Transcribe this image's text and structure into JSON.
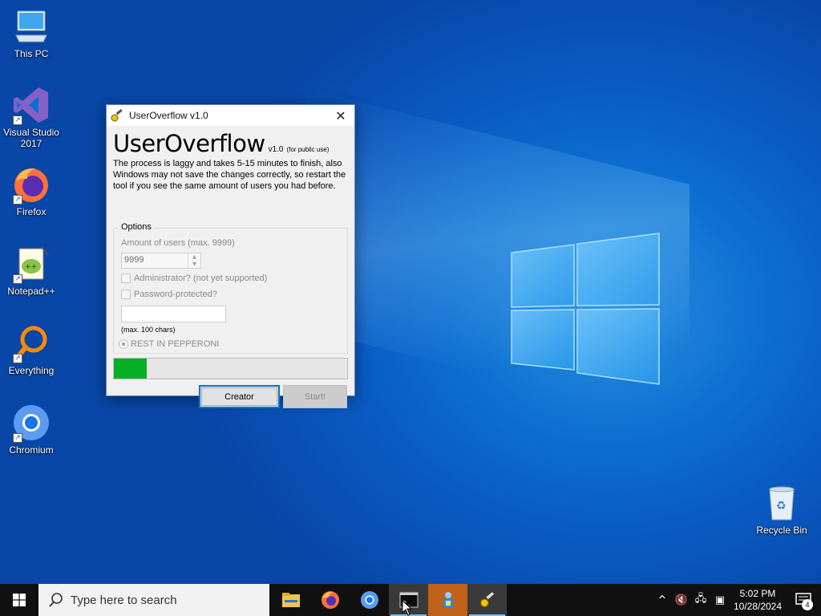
{
  "desktop": {
    "icons": [
      {
        "label": "This PC",
        "icon": "computer-icon"
      },
      {
        "label": "Visual Studio\n2017",
        "icon": "visual-studio-icon"
      },
      {
        "label": "Firefox",
        "icon": "firefox-icon"
      },
      {
        "label": "Notepad++",
        "icon": "notepadpp-icon"
      },
      {
        "label": "Everything",
        "icon": "everything-search-icon"
      },
      {
        "label": "Chromium",
        "icon": "chromium-icon"
      },
      {
        "label": "Recycle Bin",
        "icon": "recycle-bin-icon"
      }
    ]
  },
  "dialog": {
    "title": "UserOverflow v1.0",
    "heading": "UserOverflow",
    "version": "v1.0",
    "public_note": "(for public use)",
    "description": "The process is laggy and takes 5-15 minutes to finish, also Windows may not save the changes correctly, so restart the tool if you see the same amount of users you had before.",
    "options_legend": "Options",
    "amount_label": "Amount of users (max. 9999)",
    "amount_value": "9999",
    "admin_label": "Administrator? (not yet supported)",
    "admin_checked": false,
    "password_label": "Password-protected?",
    "password_checked": false,
    "password_value": "",
    "password_hint": "(max. 100 chars)",
    "radio_label": "REST IN PEPPERONI",
    "radio_selected": true,
    "progress": 0.14,
    "creator_button": "Creator",
    "start_button": "Start!"
  },
  "taskbar": {
    "search_placeholder": "Type here to search",
    "apps": [
      "file-explorer-icon",
      "firefox-icon",
      "chromium-icon",
      "terminal-icon",
      "network-app-icon",
      "useroverflow-icon"
    ],
    "clock_time": "5:02 PM",
    "clock_date": "10/28/2024",
    "notification_count": "4"
  },
  "colors": {
    "progress_fill": "#06b025",
    "accent": "#0078d7",
    "taskbar": "#101010"
  }
}
